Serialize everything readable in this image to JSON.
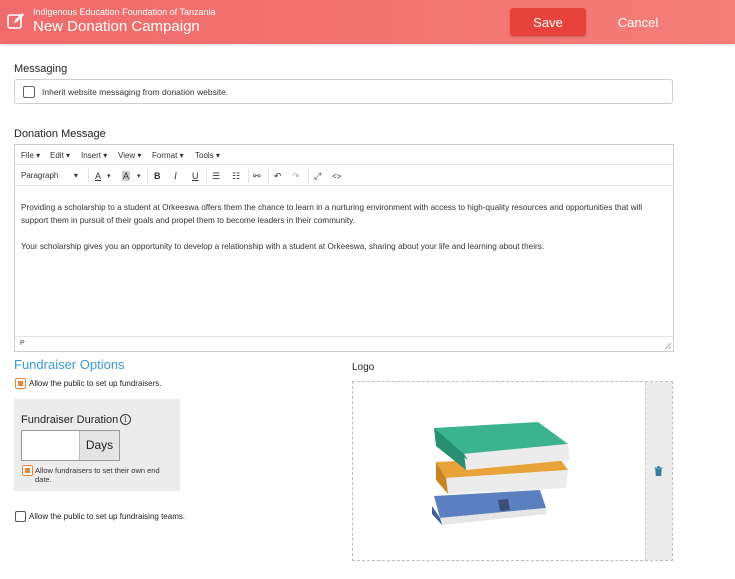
{
  "header": {
    "org": "Indigenous Education Foundation of Tanzania",
    "title": "New Donation Campaign",
    "save_label": "Save",
    "cancel_label": "Cancel",
    "icon": "edit-icon"
  },
  "messaging": {
    "label": "Messaging",
    "inherit_label": "Inherit website messaging from donation website.",
    "inherit_checked": false
  },
  "donation_message": {
    "label": "Donation Message",
    "menus": [
      "File",
      "Edit",
      "Insert",
      "View",
      "Format",
      "Tools"
    ],
    "block_format": "Paragraph",
    "paragraphs": [
      "Providing a scholarship to a student at Orkeeswa offers them the chance to learn in a nurturing environment with access to high-quality resources and opportunities that will support them in pursuit of their goals and propel them to become leaders in their community.",
      "Your scholarship gives you an opportunity to develop a relationship with a student at Orkeeswa, sharing about your life and learning about theirs."
    ],
    "status_path": "P"
  },
  "fundraiser": {
    "title": "Fundraiser Options",
    "allow_public_label": "Allow the public to set up fundraisers.",
    "allow_public_checked": true,
    "duration_label": "Fundraiser Duration",
    "duration_value": "",
    "duration_unit": "Days",
    "own_end_label": "Allow fundraisers to set their own end date.",
    "own_end_checked": true,
    "teams_label": "Allow the public to set up fundraising teams.",
    "teams_checked": false
  },
  "logo": {
    "label": "Logo",
    "image": "stack-of-books",
    "delete_icon": "trash-icon"
  },
  "colors": {
    "header": "#f06b6b",
    "save_button": "#e8433a",
    "accent_blue": "#3a9ad9",
    "checkbox_orange": "#e8843a"
  }
}
